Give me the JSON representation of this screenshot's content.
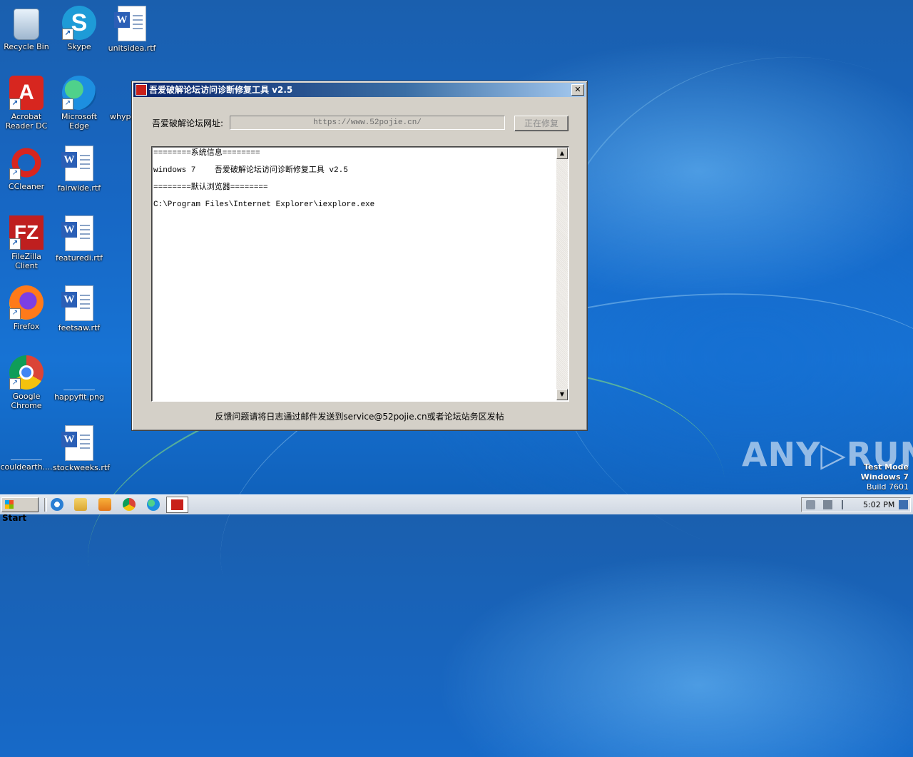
{
  "desktop": {
    "icons": [
      {
        "label": "Recycle Bin"
      },
      {
        "label": "Skype"
      },
      {
        "label": "unitsidea.rtf"
      },
      {
        "label": "Acrobat Reader DC"
      },
      {
        "label": "Microsoft Edge"
      },
      {
        "label": "whypa"
      },
      {
        "label": "CCleaner"
      },
      {
        "label": "fairwide.rtf"
      },
      {
        "label": "FileZilla Client"
      },
      {
        "label": "featuredi.rtf"
      },
      {
        "label": "Firefox"
      },
      {
        "label": "feetsaw.rtf"
      },
      {
        "label": "Google Chrome"
      },
      {
        "label": "happyfit.png"
      },
      {
        "label": "couldearth...."
      },
      {
        "label": "stockweeks.rtf"
      }
    ]
  },
  "window": {
    "title": "吾爱破解论坛访问诊断修复工具 v2.5",
    "close_label": "✕",
    "url_label": "吾爱破解论坛网址:",
    "url_value": "https://www.52pojie.cn/",
    "fix_button": "正在修复",
    "log_lines": [
      "========系统信息========",
      "windows 7    吾爱破解论坛访问诊断修复工具 v2.5",
      "========默认浏览器========",
      "C:\\Program Files\\Internet Explorer\\iexplore.exe"
    ],
    "footer": "反馈问题请将日志通过邮件发送到service@52pojie.cn或者论坛站务区发帖"
  },
  "watermark": {
    "text": "ANY▷RUN"
  },
  "test_mode": {
    "line1": "Test Mode",
    "line2": "Windows 7",
    "line3": "Build 7601"
  },
  "taskbar": {
    "start_label": "Start",
    "clock": "5:02 PM"
  },
  "colors": {
    "accent": "#0a246a",
    "desktop": "#1767c4",
    "app_icon": "#c8201a"
  }
}
